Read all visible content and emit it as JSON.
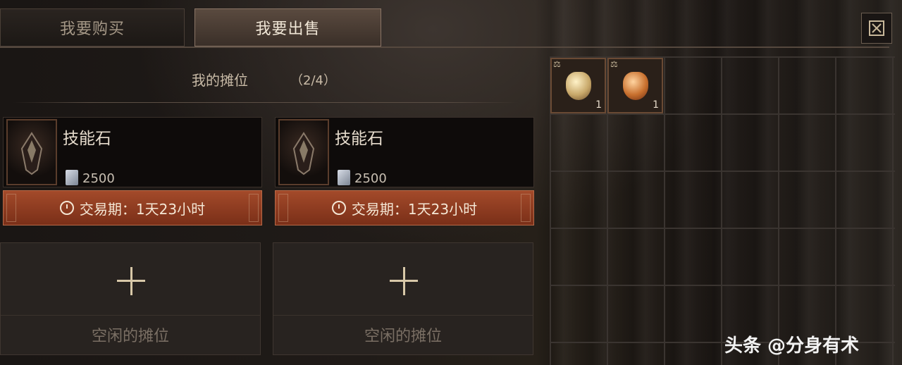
{
  "tabs": {
    "buy": "我要购买",
    "sell": "我要出售"
  },
  "stall": {
    "title": "我的摊位",
    "count": "（2/4）"
  },
  "listings": [
    {
      "name": "技能石",
      "price": "2500",
      "timer": "交易期：1天23小时"
    },
    {
      "name": "技能石",
      "price": "2500",
      "timer": "交易期：1天23小时"
    }
  ],
  "empty_slots": [
    {
      "label": "空闲的摊位"
    },
    {
      "label": "空闲的摊位"
    }
  ],
  "inventory": [
    {
      "count": "1",
      "icon": "pale-gem-icon"
    },
    {
      "count": "1",
      "icon": "amber-gem-icon"
    }
  ],
  "watermark": "头条 @分身有术",
  "colors": {
    "accent": "#a34a2a",
    "active_tab": "#5a4a3f"
  }
}
